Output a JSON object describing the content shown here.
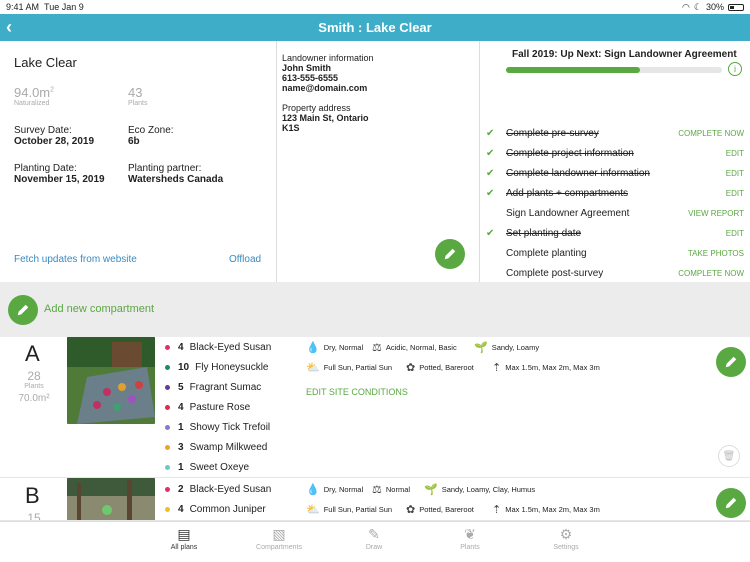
{
  "status_bar": {
    "time": "9:41 AM",
    "date": "Tue Jan 9",
    "battery": "30%"
  },
  "nav": {
    "title": "Smith : Lake Clear",
    "back_icon": "chevron-left-icon"
  },
  "project": {
    "name": "Lake Clear",
    "area_value": "94.0m",
    "area_sup": "2",
    "area_label": "Naturalized",
    "plants_value": "43",
    "plants_label": "Plants",
    "survey_label": "Survey Date:",
    "survey_value": "October 28, 2019",
    "eco_label": "Eco Zone:",
    "eco_value": "6b",
    "planting_label": "Planting Date:",
    "planting_value": "November 15, 2019",
    "partner_label": "Planting partner:",
    "partner_value": "Watersheds Canada",
    "fetch_link": "Fetch updates from website",
    "offload_link": "Offload"
  },
  "landowner": {
    "heading": "Landowner information",
    "name": "John Smith",
    "phone": "613-555-6555",
    "email": "name@domain.com",
    "address_heading": "Property address",
    "address1": "123 Main St, Ontario",
    "address2": "K1S"
  },
  "progress": {
    "title": "Fall 2019: Up Next: Sign Landowner Agreement",
    "fraction": 0.62,
    "tasks": [
      {
        "label": "Complete pre-survey",
        "action": "COMPLETE NOW",
        "done": true
      },
      {
        "label": "Complete project information",
        "action": "EDIT",
        "done": true
      },
      {
        "label": "Complete landowner information",
        "action": "EDIT",
        "done": true
      },
      {
        "label": "Add plants + compartments",
        "action": "EDIT",
        "done": true
      },
      {
        "label": "Sign Landowner Agreement",
        "action": "VIEW REPORT",
        "done": false
      },
      {
        "label": "Set planting date",
        "action": "EDIT",
        "done": true
      },
      {
        "label": "Complete planting",
        "action": "TAKE PHOTOS",
        "done": false
      },
      {
        "label": "Complete post-survey",
        "action": "COMPLETE NOW",
        "done": false
      }
    ]
  },
  "add_compartment": "Add new compartment",
  "compartments": [
    {
      "letter": "A",
      "plants_value": "28",
      "plants_label": "Plants",
      "area": "70.0m²",
      "plants": [
        {
          "count": "4",
          "name": "Black-Eyed Susan",
          "color": "#e0306a"
        },
        {
          "count": "10",
          "name": "Fly Honeysuckle",
          "color": "#1b8a6b"
        },
        {
          "count": "5",
          "name": "Fragrant Sumac",
          "color": "#5b3f9a"
        },
        {
          "count": "4",
          "name": "Pasture Rose",
          "color": "#d6304a"
        },
        {
          "count": "1",
          "name": "Showy Tick Trefoil",
          "color": "#8a78c8"
        },
        {
          "count": "3",
          "name": "Swamp Milkweed",
          "color": "#f0a030"
        },
        {
          "count": "1",
          "name": "Sweet Oxeye",
          "color": "#6ec8c0"
        }
      ],
      "moisture": "Dry, Normal",
      "ph": "Acidic, Normal, Basic",
      "soil": "Sandy, Loamy",
      "sun": "Full Sun, Partial Sun",
      "stock": "Potted, Bareroot",
      "size": "Max 1.5m, Max 2m, Max 3m",
      "edit_site": "EDIT SITE CONDITIONS"
    },
    {
      "letter": "B",
      "plants_value": "15",
      "plants": [
        {
          "count": "2",
          "name": "Black-Eyed Susan",
          "color": "#e0306a"
        },
        {
          "count": "4",
          "name": "Common Juniper",
          "color": "#f0c020"
        }
      ],
      "moisture": "Dry, Normal",
      "ph": "Normal",
      "soil": "Sandy, Loamy, Clay, Humus",
      "sun": "Full Sun, Partial Sun",
      "stock": "Potted, Bareroot",
      "size": "Max 1.5m, Max 2m, Max 3m"
    }
  ],
  "tabs": [
    {
      "label": "All plans",
      "icon": "stack-icon",
      "active": true
    },
    {
      "label": "Compartments",
      "icon": "image-icon",
      "active": false
    },
    {
      "label": "Draw",
      "icon": "pencil-icon",
      "active": false
    },
    {
      "label": "Plants",
      "icon": "leaf-icon",
      "active": false
    },
    {
      "label": "Settings",
      "icon": "gear-icon",
      "active": false
    }
  ],
  "colors": {
    "brand": "#3dadc8",
    "accent": "#5aa842"
  }
}
